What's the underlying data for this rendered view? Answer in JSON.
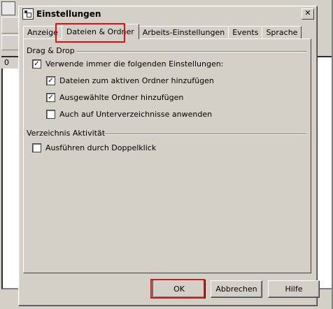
{
  "background": {
    "list_header": "0"
  },
  "dialog": {
    "title": "Einstellungen",
    "close_symbol": "✕",
    "tabs": [
      {
        "label": "Anzeige",
        "active": false
      },
      {
        "label": "Dateien & Ordner",
        "active": true
      },
      {
        "label": "Arbeits-Einstellungen",
        "active": false
      },
      {
        "label": "Events",
        "active": false
      },
      {
        "label": "Sprache",
        "active": false
      }
    ],
    "sections": {
      "drag_drop": {
        "title": "Drag & Drop",
        "options": [
          {
            "label": "Verwende immer die folgenden Einstellungen:",
            "checked": true
          },
          {
            "label": "Dateien zum aktiven Ordner hinzufügen",
            "checked": true
          },
          {
            "label": "Ausgewählte Ordner hinzufügen",
            "checked": true
          },
          {
            "label": "Auch auf Unterverzeichnisse anwenden",
            "checked": false
          }
        ]
      },
      "verzeichnis": {
        "title": "Verzeichnis Aktivität",
        "options": [
          {
            "label": "Ausführen durch Doppelklick",
            "checked": false
          }
        ]
      }
    },
    "buttons": {
      "ok": "OK",
      "cancel": "Abbrechen",
      "help": "Hilfe"
    },
    "check_mark": "✓",
    "highlight_color": "#e01010"
  }
}
